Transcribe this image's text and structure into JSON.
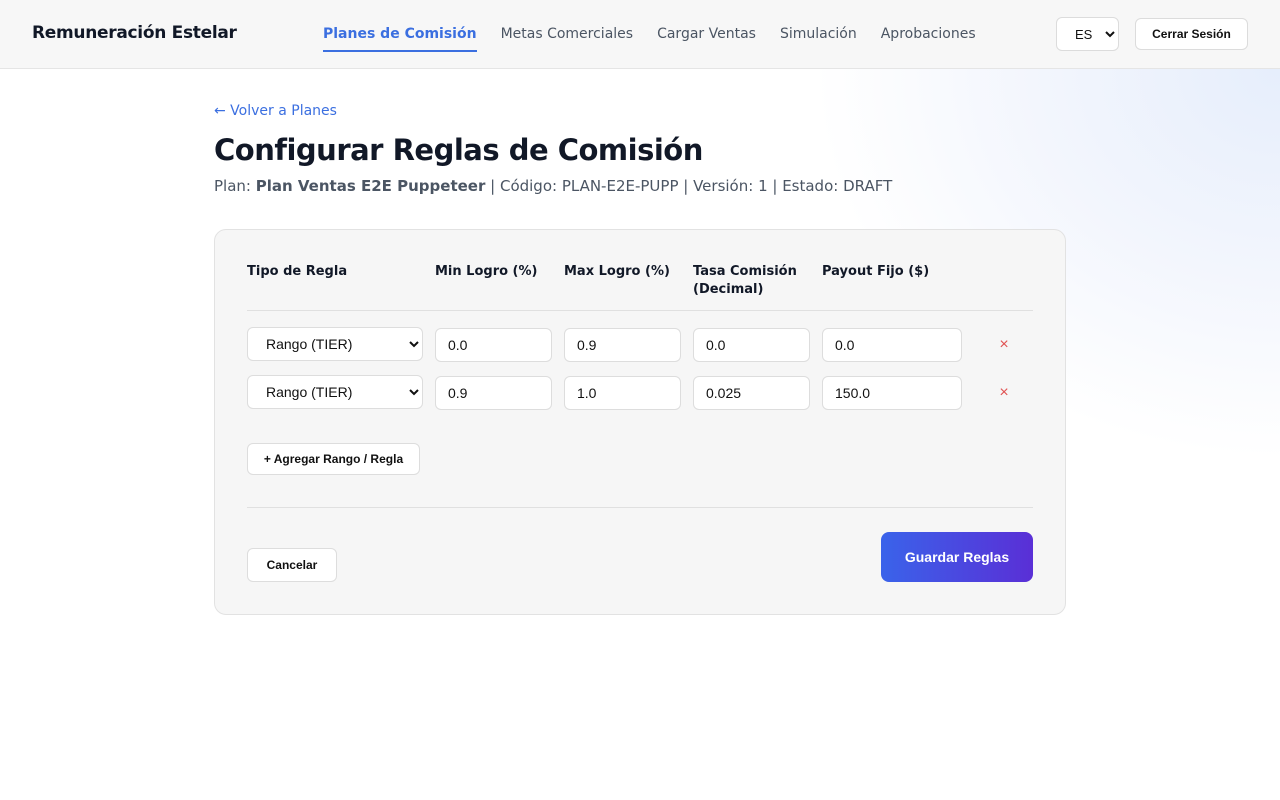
{
  "header": {
    "brand": "Remuneración Estelar",
    "nav": [
      {
        "label": "Planes de Comisión",
        "active": true
      },
      {
        "label": "Metas Comerciales",
        "active": false
      },
      {
        "label": "Cargar Ventas",
        "active": false
      },
      {
        "label": "Simulación",
        "active": false
      },
      {
        "label": "Aprobaciones",
        "active": false
      }
    ],
    "language": "ES",
    "logout_label": "Cerrar Sesión"
  },
  "page": {
    "back_label": "← Volver a Planes",
    "title": "Configurar Reglas de Comisión",
    "plan_prefix": "Plan: ",
    "plan_name": "Plan Ventas E2E Puppeteer",
    "plan_details": " | Código: PLAN-E2E-PUPP | Versión: 1 | Estado: DRAFT"
  },
  "rules_table": {
    "columns": [
      "Tipo de Regla",
      "Min Logro (%)",
      "Max Logro (%)",
      "Tasa Comisión (Decimal)",
      "Payout Fijo ($)"
    ],
    "rows": [
      {
        "type": "Rango (TIER)",
        "min": "0.0",
        "max": "0.9",
        "rate": "0.0",
        "payout": "0.0",
        "remove": "×"
      },
      {
        "type": "Rango (TIER)",
        "min": "0.9",
        "max": "1.0",
        "rate": "0.025",
        "payout": "150.0",
        "remove": "×"
      }
    ],
    "add_label": "+ Agregar Rango / Regla",
    "cancel_label": "Cancelar",
    "save_label": "Guardar Reglas"
  },
  "colors": {
    "accent": "#3b6fe0",
    "save_gradient_start": "#3a63ea",
    "save_gradient_end": "#5a2fd6",
    "remove": "#e05252"
  }
}
